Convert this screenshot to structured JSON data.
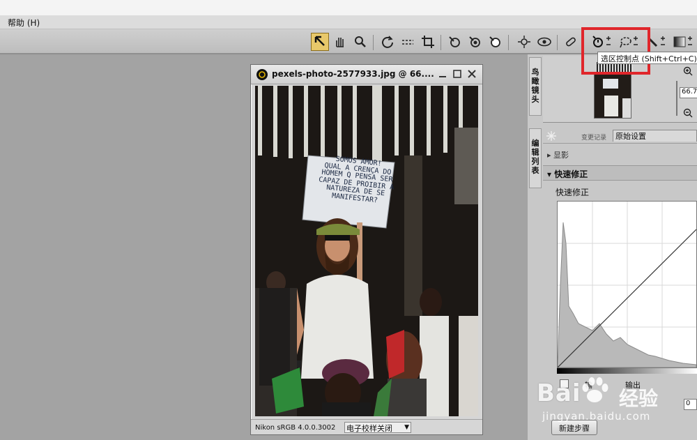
{
  "menubar": {
    "help": "帮助 (H)"
  },
  "toolbar": {
    "tooltip": "选区控制点 (Shift+Ctrl+C)",
    "tools": [
      "select-pointer",
      "hand",
      "zoom",
      "rotate",
      "straighten",
      "crop",
      "color-control-point",
      "black-point",
      "white-point",
      "red-eye",
      "auto-retouch",
      "watch-eye",
      "brush",
      "selection-control-point",
      "lasso",
      "selection-brush",
      "selection-gradient"
    ]
  },
  "image_window": {
    "title": "pexels-photo-2577933.jpg  @  66....",
    "profile": "Nikon sRGB 4.0.0.3002",
    "softproof": "电子校样关闭",
    "sign_lines": [
      "SOMOS AMOR!",
      "QUAL A CRENÇA DO",
      "HOMEM Q PENSA SER",
      "CAPAZ DE PROIBIR A",
      "NATUREZA DE SE",
      "MANIFESTAR?"
    ]
  },
  "birdseye": {
    "tab_chars": [
      "鸟",
      "瞰",
      "镜",
      "头"
    ],
    "zoom_value": "66.7",
    "zoom_unit": "%"
  },
  "editlist": {
    "tab_chars": [
      "编",
      "辑",
      "列",
      "表"
    ],
    "change_log": "变更记录",
    "original_settings": "原始设置",
    "develop": "▸ 显影",
    "quickfix_header": "▾ 快速修正",
    "quickfix_label": "快速修正",
    "input_label": "输",
    "output_label": "输出",
    "output_value": "0",
    "new_step": "新建步骤"
  },
  "watermark": {
    "main": "Bai",
    "suffix": "经验",
    "url": "jingyan.baidu.com"
  },
  "colors": {
    "highlight": "#e0262b",
    "active_tool": "#e8c86a"
  }
}
